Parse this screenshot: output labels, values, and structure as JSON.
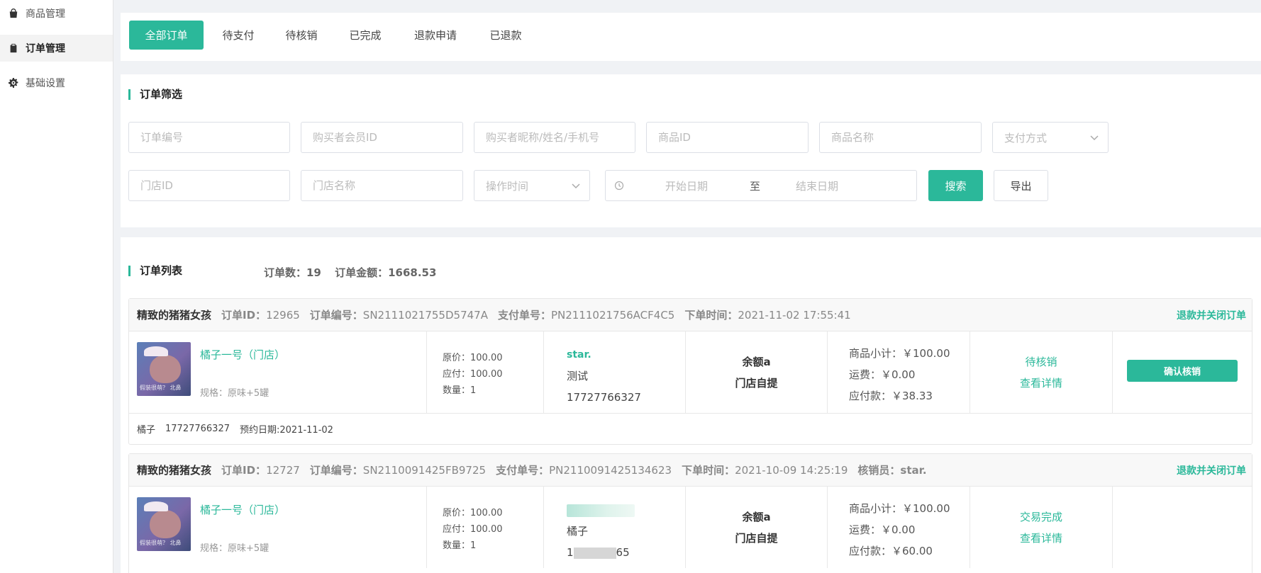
{
  "sidebar": {
    "items": [
      {
        "label": "商品管理",
        "icon": "bag-icon"
      },
      {
        "label": "订单管理",
        "icon": "clipboard-icon",
        "active": true
      },
      {
        "label": "基础设置",
        "icon": "gear-icon"
      }
    ]
  },
  "tabs": [
    {
      "label": "全部订单",
      "active": true
    },
    {
      "label": "待支付"
    },
    {
      "label": "待核销"
    },
    {
      "label": "已完成"
    },
    {
      "label": "退款申请"
    },
    {
      "label": "已退款"
    }
  ],
  "filter": {
    "title": "订单筛选",
    "order_no_placeholder": "订单编号",
    "member_id_placeholder": "购买者会员ID",
    "buyer_info_placeholder": "购买者昵称/姓名/手机号",
    "product_id_placeholder": "商品ID",
    "product_name_placeholder": "商品名称",
    "pay_method_placeholder": "支付方式",
    "store_id_placeholder": "门店ID",
    "store_name_placeholder": "门店名称",
    "op_time_placeholder": "操作时间",
    "start_date_placeholder": "开始日期",
    "range_sep": "至",
    "end_date_placeholder": "结束日期",
    "search_label": "搜索",
    "export_label": "导出"
  },
  "list": {
    "title": "订单列表",
    "count_text": "订单数：19",
    "amount_text": "订单金额：1668.53"
  },
  "orders": [
    {
      "shop": "精致的猪猪女孩",
      "order_id_key": "订单ID：",
      "order_id": "12965",
      "order_no_key": "订单编号：",
      "order_no": "SN2111021755D5747A",
      "pay_no_key": "支付单号：",
      "pay_no": "PN2111021756ACF4C5",
      "time_key": "下单时间：",
      "time": "2021-11-02 17:55:41",
      "close_label": "退款并关闭订单",
      "product_name": "橘子一号（门店）",
      "product_spec": "规格：原味+5罐",
      "thumb_caption": "假装很萌？ 北鼻",
      "orig_price": "原价：100.00",
      "pay_price": "应付：100.00",
      "qty": "数量：1",
      "buyer_nick": "star.",
      "buyer_name": "测试",
      "buyer_phone": "17727766327",
      "pay_method": "余额a",
      "delivery": "门店自提",
      "subtotal": "商品小计：￥100.00",
      "freight": "运费：￥0.00",
      "payable": "应付款：￥38.33",
      "status": "待核销",
      "detail_label": "查看详情",
      "op_label": "确认核销",
      "foot_name": "橘子",
      "foot_phone": "17727766327",
      "foot_date": "预约日期:2021-11-02"
    },
    {
      "shop": "精致的猪猪女孩",
      "order_id_key": "订单ID：",
      "order_id": "12727",
      "order_no_key": "订单编号：",
      "order_no": "SN2110091425FB9725",
      "pay_no_key": "支付单号：",
      "pay_no": "PN2110091425134623",
      "time_key": "下单时间：",
      "time": "2021-10-09 14:25:19",
      "verifier_key": "核销员：",
      "verifier": "star.",
      "close_label": "退款并关闭订单",
      "product_name": "橘子一号（门店）",
      "product_spec": "规格：原味+5罐",
      "thumb_caption": "假装很萌？ 北鼻",
      "orig_price": "原价：100.00",
      "pay_price": "应付：100.00",
      "qty": "数量：1",
      "buyer_name": "橘子",
      "buyer_phone_prefix": "1",
      "buyer_phone_suffix": "65",
      "pay_method": "余额a",
      "delivery": "门店自提",
      "subtotal": "商品小计：￥100.00",
      "freight": "运费：￥0.00",
      "payable": "应付款：￥60.00",
      "status": "交易完成",
      "detail_label": "查看详情"
    }
  ]
}
